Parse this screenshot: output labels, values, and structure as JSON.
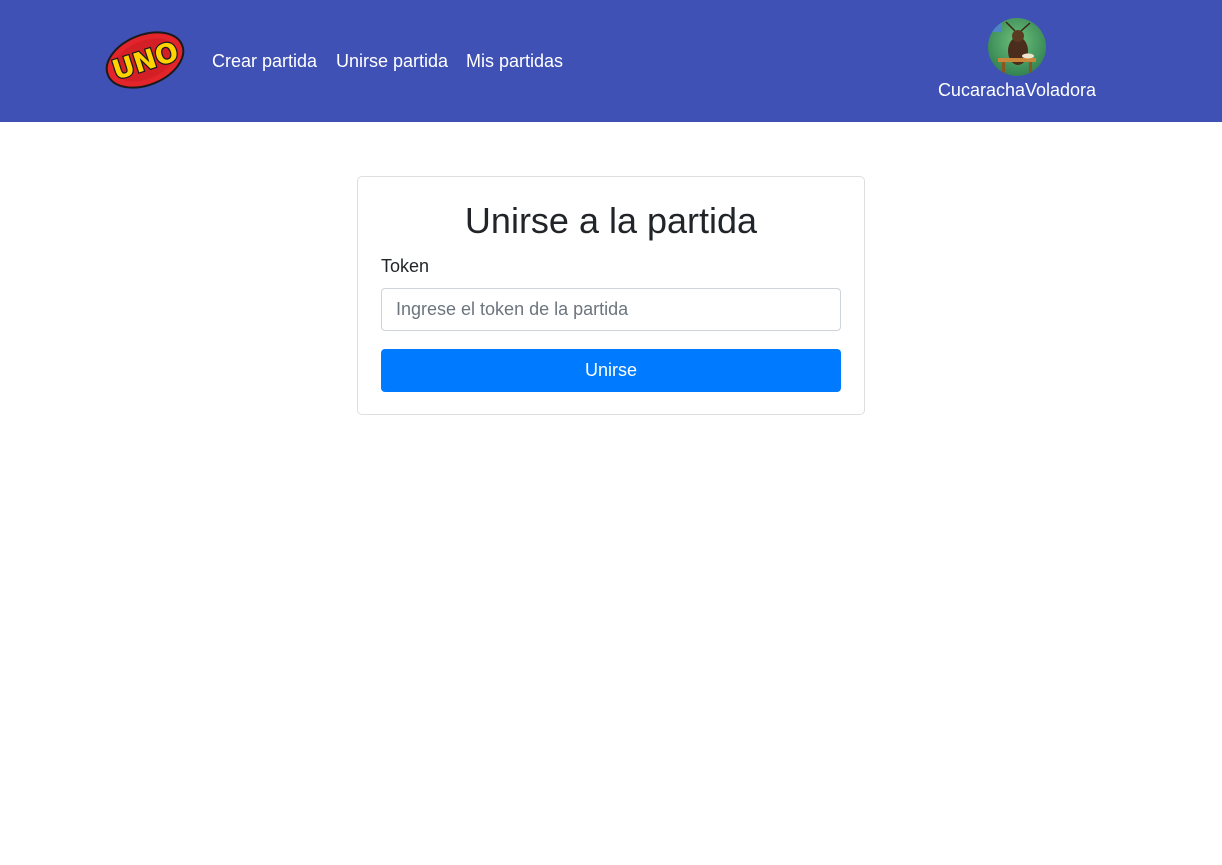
{
  "colors": {
    "navbar_bg": "#3f51b5",
    "primary_button": "#007bff",
    "nav_text": "#ffffff"
  },
  "header": {
    "logo_text": "UNO",
    "logo_icon": "uno-logo",
    "nav": [
      {
        "label": "Crear partida"
      },
      {
        "label": "Unirse partida"
      },
      {
        "label": "Mis partidas"
      }
    ],
    "user": {
      "avatar_icon": "user-avatar",
      "name": "CucarachaVoladora"
    }
  },
  "join_card": {
    "title": "Unirse a la partida",
    "token_label": "Token",
    "token_value": "",
    "token_placeholder": "Ingrese el token de la partida",
    "submit_label": "Unirse"
  }
}
